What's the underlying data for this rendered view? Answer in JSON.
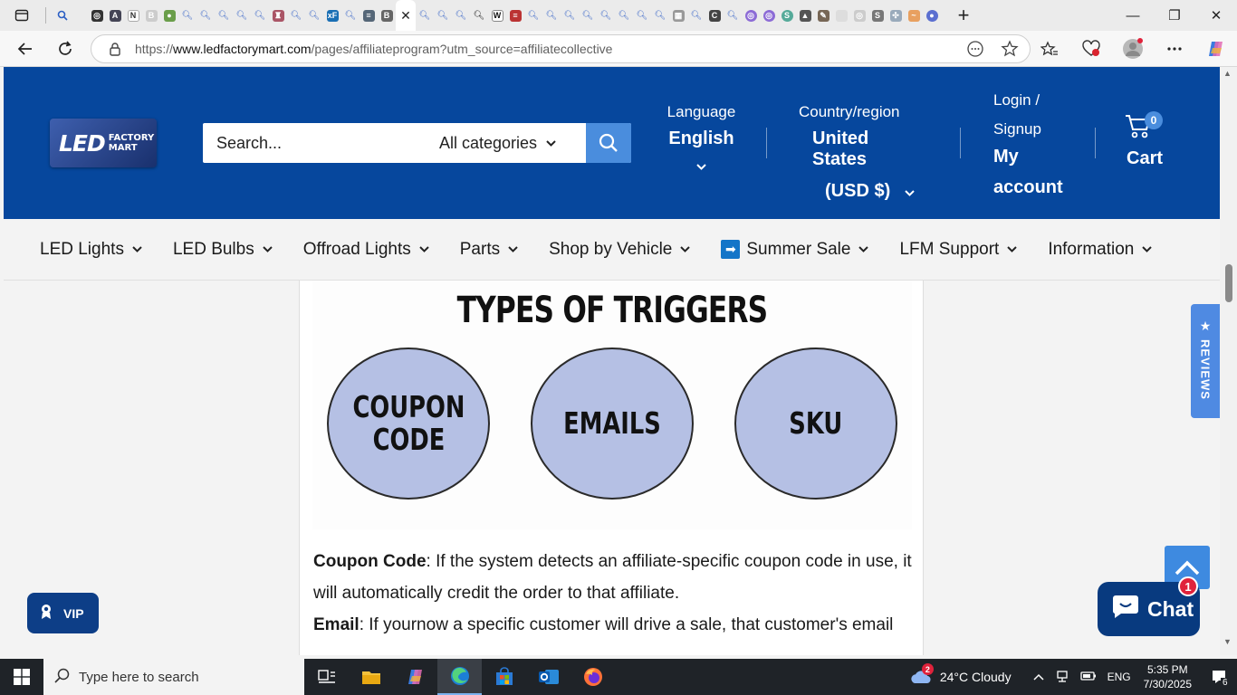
{
  "browser": {
    "url_prefix": "https://",
    "url_domain": "www.ledfactorymart.com",
    "url_path": "/pages/affiliateprogram?utm_source=affiliatecollective",
    "active_tab_close": "✕",
    "win_controls": [
      "—",
      "❐",
      "✕"
    ]
  },
  "header": {
    "logo_main": "LED",
    "logo_sub_1": "FACTORY",
    "logo_sub_2": "MART",
    "search_placeholder": "Search...",
    "category_selected": "All categories",
    "language_label": "Language",
    "language_value": "English",
    "region_label": "Country/region",
    "region_value_1": "United States",
    "region_value_2": "(USD $)",
    "login_1": "Login /",
    "login_2": "Signup",
    "account_1": "My",
    "account_2": "account",
    "cart_count": "0",
    "cart_label": "Cart"
  },
  "nav": {
    "items": [
      {
        "label": "LED Lights"
      },
      {
        "label": "LED Bulbs"
      },
      {
        "label": "Offroad Lights"
      },
      {
        "label": "Parts"
      },
      {
        "label": "Shop by Vehicle"
      },
      {
        "label": "Summer Sale"
      },
      {
        "label": "LFM Support"
      },
      {
        "label": "Information"
      }
    ]
  },
  "infographic": {
    "title": "TYPES OF TRIGGERS",
    "bubbles": [
      {
        "line1": "COUPON",
        "line2": "CODE"
      },
      {
        "line1": "EMAILS"
      },
      {
        "line1": "SKU"
      }
    ],
    "bubble_color": "#b5c0e4"
  },
  "body": {
    "p1_bold": "Coupon Code",
    "p1_text": ": If the system detects an affiliate-specific coupon code in use, it will automatically credit the order to that affiliate.",
    "p2_bold": "Email",
    "p2_text": ": If yournow a specific customer will drive a sale, that customer's email"
  },
  "widgets": {
    "reviews": "REVIEWS",
    "vip": "VIP",
    "chat": "Chat",
    "chat_badge": "1"
  },
  "taskbar": {
    "search_placeholder": "Type here to search",
    "weather_badge": "2",
    "weather": "24°C  Cloudy",
    "lang": "ENG",
    "time": "5:35 PM",
    "date": "7/30/2025",
    "notif_count": "6"
  },
  "colors": {
    "header_blue": "#06479d",
    "accent_blue": "#4a8ddd",
    "chat_navy": "#083a7f"
  }
}
